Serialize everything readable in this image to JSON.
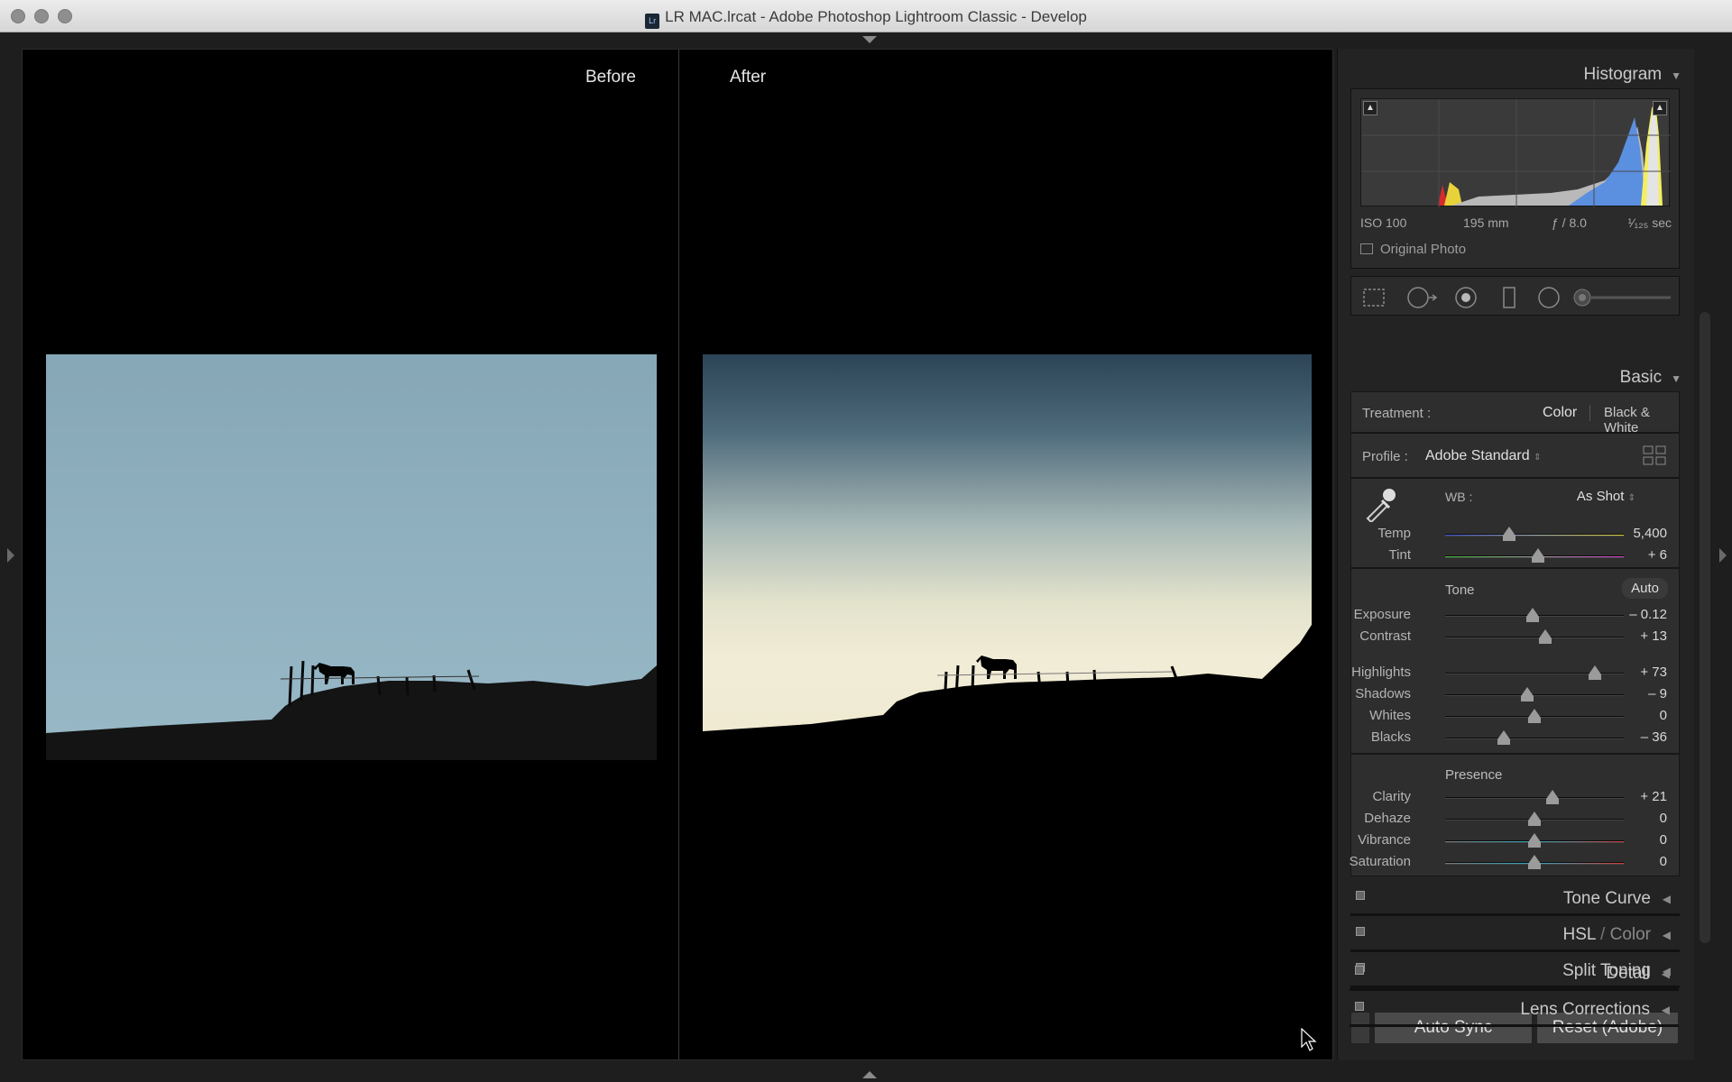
{
  "window": {
    "title": "LR MAC.lrcat - Adobe Photoshop Lightroom Classic - Develop",
    "app_icon_text": "Lr"
  },
  "viewer": {
    "before_label": "Before",
    "after_label": "After"
  },
  "histogram": {
    "header": "Histogram",
    "iso": "ISO 100",
    "focal": "195 mm",
    "aperture": "ƒ / 8.0",
    "shutter": "¹⁄₁₂₅ sec",
    "original_photo": "Original Photo"
  },
  "basic": {
    "header": "Basic",
    "treatment_label": "Treatment :",
    "treatment_color": "Color",
    "treatment_bw": "Black & White",
    "profile_label": "Profile :",
    "profile_value": "Adobe Standard",
    "wb_label": "WB :",
    "wb_value": "As Shot",
    "tone_label": "Tone",
    "auto_label": "Auto",
    "presence_label": "Presence",
    "sliders": {
      "temp": {
        "name": "Temp",
        "value": "5,400",
        "pos": 0.36
      },
      "tint": {
        "name": "Tint",
        "value": "+ 6",
        "pos": 0.52
      },
      "exposure": {
        "name": "Exposure",
        "value": "– 0.12",
        "pos": 0.49
      },
      "contrast": {
        "name": "Contrast",
        "value": "+ 13",
        "pos": 0.56
      },
      "highlights": {
        "name": "Highlights",
        "value": "+ 73",
        "pos": 0.84
      },
      "shadows": {
        "name": "Shadows",
        "value": "– 9",
        "pos": 0.46
      },
      "whites": {
        "name": "Whites",
        "value": "0",
        "pos": 0.5
      },
      "blacks": {
        "name": "Blacks",
        "value": "– 36",
        "pos": 0.33
      },
      "clarity": {
        "name": "Clarity",
        "value": "+ 21",
        "pos": 0.6
      },
      "dehaze": {
        "name": "Dehaze",
        "value": "0",
        "pos": 0.5
      },
      "vibrance": {
        "name": "Vibrance",
        "value": "0",
        "pos": 0.5
      },
      "saturation": {
        "name": "Saturation",
        "value": "0",
        "pos": 0.5
      }
    }
  },
  "panels": {
    "tone_curve": "Tone Curve",
    "hsl_a": "HSL",
    "hsl_sep": " / ",
    "hsl_b": "Color",
    "split_toning": "Split Toning",
    "detail": "Detail",
    "lens_corrections": "Lens Corrections"
  },
  "buttons": {
    "auto_sync": "Auto Sync",
    "reset": "Reset (Adobe)"
  }
}
